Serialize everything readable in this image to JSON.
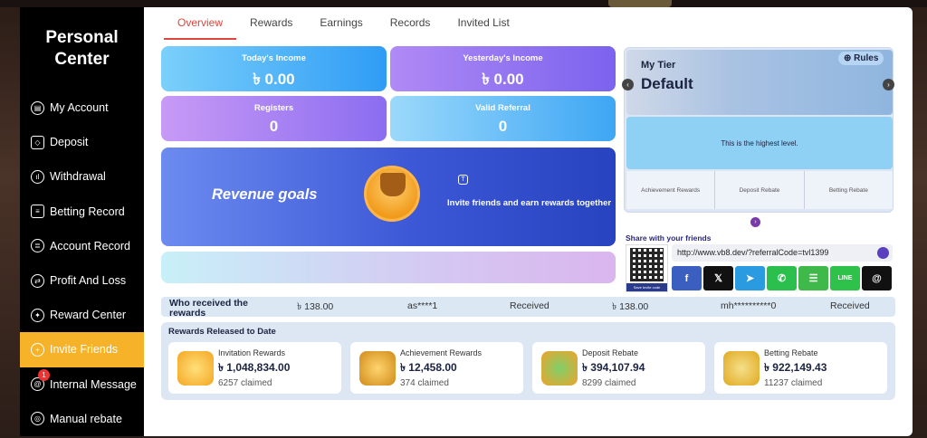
{
  "sidebar": {
    "title_line1": "Personal",
    "title_line2": "Center",
    "items": [
      {
        "label": "My Account"
      },
      {
        "label": "Deposit"
      },
      {
        "label": "Withdrawal"
      },
      {
        "label": "Betting Record"
      },
      {
        "label": "Account Record"
      },
      {
        "label": "Profit And Loss"
      },
      {
        "label": "Reward Center"
      },
      {
        "label": "Invite Friends",
        "active": true
      },
      {
        "label": "Internal Message",
        "badge": "1"
      },
      {
        "label": "Manual rebate"
      }
    ]
  },
  "tabs": [
    "Overview",
    "Rewards",
    "Earnings",
    "Records",
    "Invited List"
  ],
  "stats": {
    "today_label": "Today's Income",
    "today_value": "৳ 0.00",
    "yesterday_label": "Yesterday's Income",
    "yesterday_value": "৳ 0.00",
    "registers_label": "Registers",
    "registers_value": "0",
    "valid_label": "Valid Referral",
    "valid_value": "0"
  },
  "goals": {
    "title": "Revenue goals",
    "desc": "Invite friends and earn rewards together"
  },
  "tier": {
    "my_tier": "My Tier",
    "name": "Default",
    "rules": "Rules",
    "highest": "This is the highest level.",
    "cols": [
      "Achievement Rewards",
      "Deposit Rebate",
      "Betting Rebate"
    ]
  },
  "share": {
    "title": "Share with your friends",
    "link": "http://www.vb8.dev/?referralCode=tvl1399",
    "qr_button": "Save Invite code",
    "socials": [
      "f",
      "𝕏",
      "➤",
      "✆",
      "☰",
      "LINE",
      "@"
    ]
  },
  "ticker": {
    "title": "Who received the rewards",
    "amount1": "৳ 138.00",
    "user1": "as****1",
    "status1": "Received",
    "amount2": "৳ 138.00",
    "user2": "mh**********0",
    "status2": "Received"
  },
  "rewards": {
    "title": "Rewards Released to Date",
    "cards": [
      {
        "name": "Invitation Rewards",
        "amount": "৳ 1,048,834.00",
        "claimed": "6257 claimed"
      },
      {
        "name": "Achievement Rewards",
        "amount": "৳ 12,458.00",
        "claimed": "374 claimed"
      },
      {
        "name": "Deposit Rebate",
        "amount": "৳ 394,107.94",
        "claimed": "8299 claimed"
      },
      {
        "name": "Betting Rebate",
        "amount": "৳ 922,149.43",
        "claimed": "11237 claimed"
      }
    ]
  }
}
